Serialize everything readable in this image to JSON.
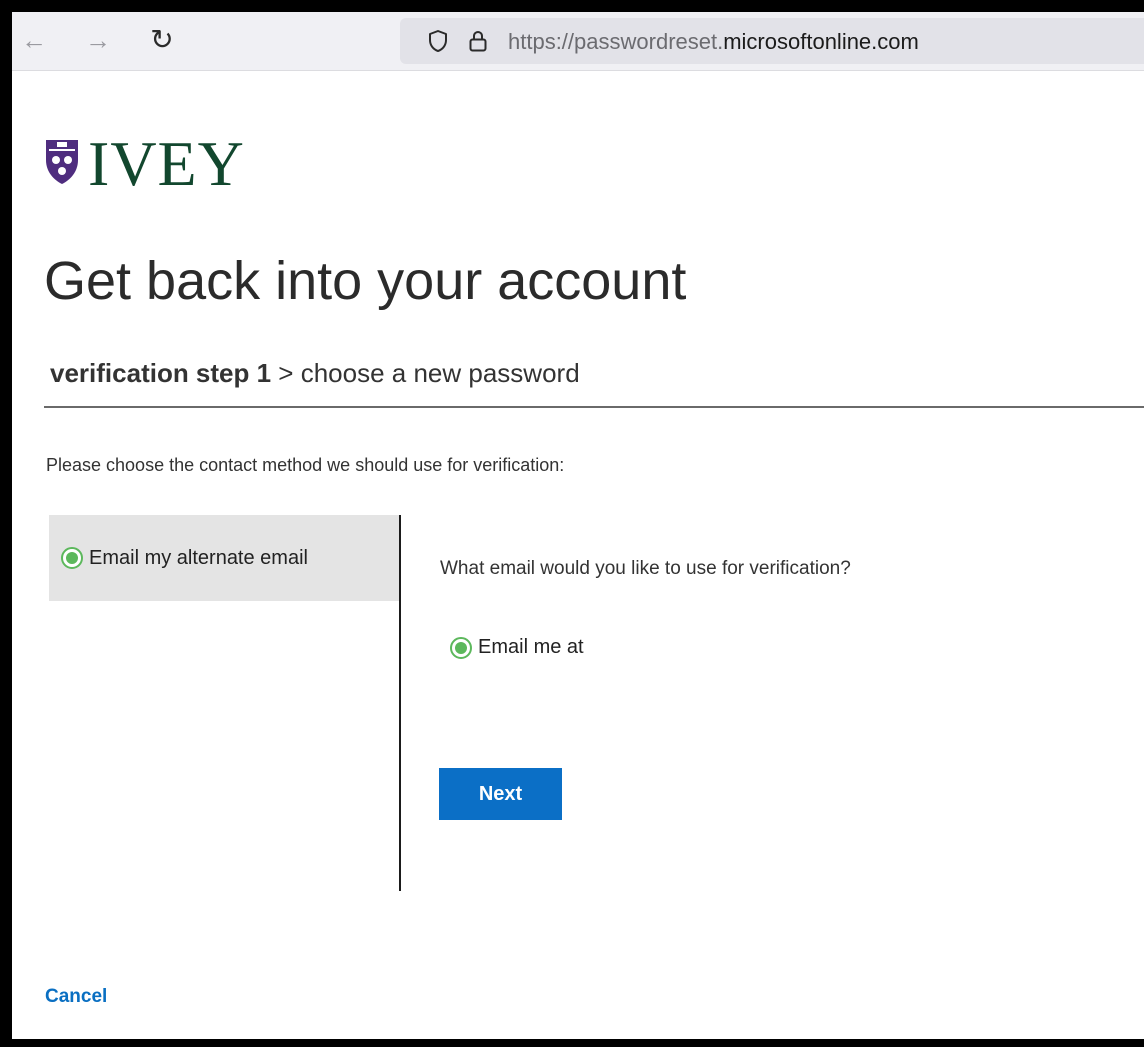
{
  "browser": {
    "back_icon": "arrow-left-icon",
    "forward_icon": "arrow-right-icon",
    "reload_icon": "reload-icon",
    "url_prefix": "https://passwordreset.",
    "url_domain": "microsoftonline.com"
  },
  "brand": {
    "logo_text": "IVEY",
    "color": "#12472e",
    "crest_color": "#4f2d7f"
  },
  "page": {
    "title": "Get back into your account",
    "steps": {
      "current": "verification step 1",
      "separator": " > ",
      "next": "choose a new password"
    },
    "instruction": "Please choose the contact method we should use for verification:"
  },
  "methods": [
    {
      "label": "Email my alternate email",
      "selected": true
    }
  ],
  "details": {
    "question": "What email would you like to use for verification?",
    "option_label": "Email me at",
    "next_label": "Next"
  },
  "cancel_label": "Cancel",
  "colors": {
    "accent": "#0b6fc6",
    "radio_selected": "#5cb85c",
    "link": "#0a6fc2"
  }
}
